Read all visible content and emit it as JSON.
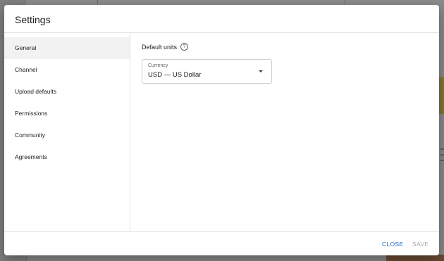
{
  "dialog": {
    "title": "Settings"
  },
  "sidebar": {
    "items": [
      {
        "label": "General",
        "active": true
      },
      {
        "label": "Channel",
        "active": false
      },
      {
        "label": "Upload defaults",
        "active": false
      },
      {
        "label": "Permissions",
        "active": false
      },
      {
        "label": "Community",
        "active": false
      },
      {
        "label": "Agreements",
        "active": false
      }
    ]
  },
  "content": {
    "section_title": "Default units",
    "help_icon": "question-circle-icon",
    "currency": {
      "label": "Currency",
      "value": "USD — US Dollar"
    }
  },
  "footer": {
    "close_label": "CLOSE",
    "save_label": "SAVE"
  },
  "colors": {
    "accent": "#1a66c9",
    "disabled": "#a8a8a8",
    "active_item_bg": "#f2f2f2"
  }
}
